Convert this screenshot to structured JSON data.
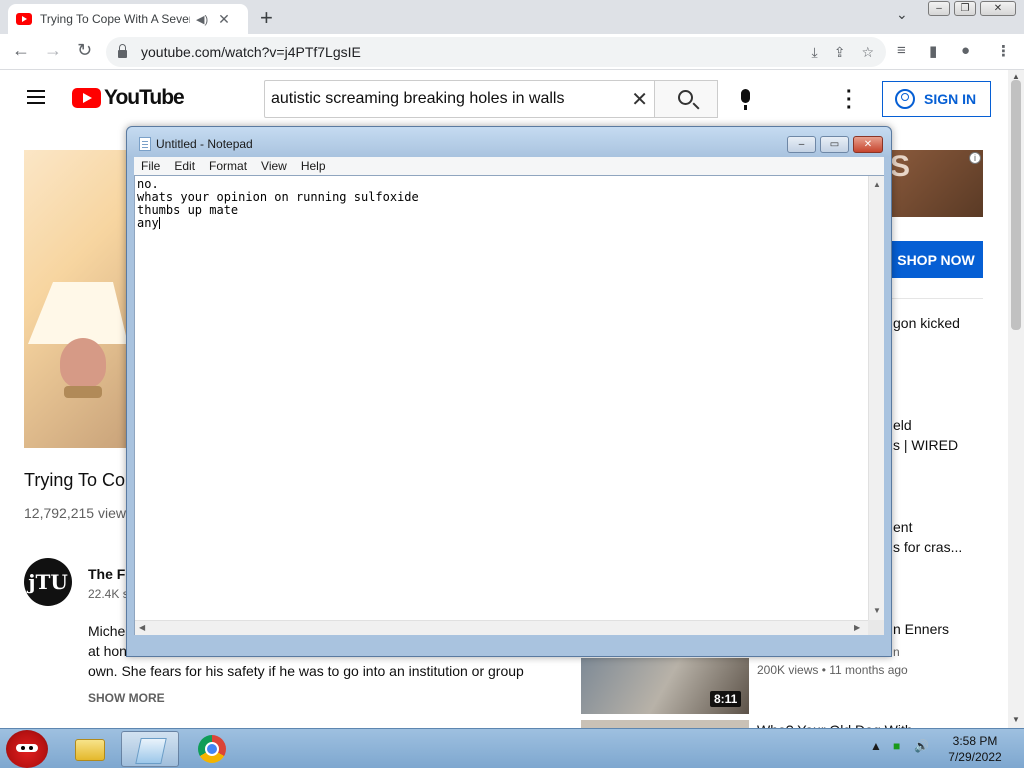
{
  "browser": {
    "tab_title": "Trying To Cope With A Severely Autistic Son",
    "new_tab": "+",
    "url": "youtube.com/watch?v=j4PTf7LgsIE"
  },
  "youtube": {
    "logo_text": "YouTube",
    "search_query": "autistic screaming breaking holes in walls",
    "sign_in": "SIGN IN",
    "video_title": "Trying To Co",
    "views": "12,792,215 view",
    "channel_avatar_text": "jTU",
    "channel_name": "The Fl",
    "subscribers": "22.4K s",
    "description_lines": [
      "Miche",
      "at hon",
      "own. She fears for his safety if he was to go into an institution or group"
    ],
    "show_more": "SHOW MORE"
  },
  "sidebar": {
    "ad_text": "S",
    "ad_info": "i",
    "shop_now": "SHOP NOW",
    "items": [
      {
        "title": "gon kicked"
      },
      {
        "title": "eld",
        "subtitle": "s | WIRED"
      },
      {
        "title": "ent",
        "subtitle": "s for cras..."
      },
      {
        "title": "n Enners",
        "meta_partial": "n",
        "meta": "200K views • 11 months ago",
        "duration": "8:11"
      },
      {
        "title": "Who? Your Old Dog With"
      }
    ]
  },
  "notepad": {
    "title": "Untitled - Notepad",
    "menus": [
      "File",
      "Edit",
      "Format",
      "View",
      "Help"
    ],
    "text_lines": [
      "no.",
      "whats your opinion on running sulfoxide",
      "thumbs up mate",
      "any"
    ]
  },
  "taskbar": {
    "time": "3:58 PM",
    "date": "7/29/2022"
  }
}
